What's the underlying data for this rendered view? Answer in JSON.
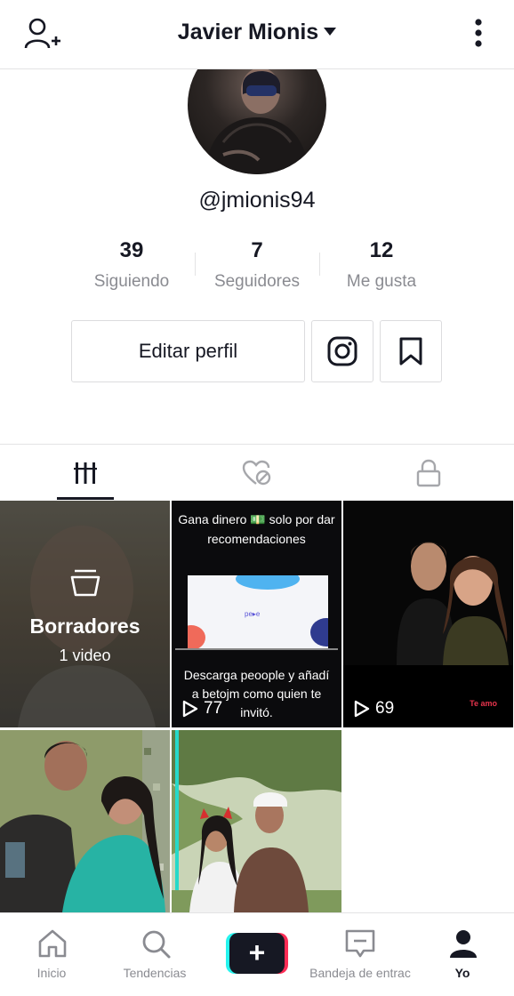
{
  "header": {
    "title": "Javier Mionis",
    "add_user_icon": "add-person-icon",
    "menu_icon": "more-vertical-icon"
  },
  "profile": {
    "handle": "@jmionis94",
    "stats": [
      {
        "value": "39",
        "label": "Siguiendo"
      },
      {
        "value": "7",
        "label": "Seguidores"
      },
      {
        "value": "12",
        "label": "Me gusta"
      }
    ],
    "edit_button_label": "Editar perfil",
    "instagram_icon": "instagram-icon",
    "bookmark_icon": "bookmark-icon"
  },
  "tabs": [
    {
      "icon": "grid-videos-icon",
      "active": true
    },
    {
      "icon": "liked-hidden-icon",
      "active": false
    },
    {
      "icon": "lock-icon",
      "active": false
    }
  ],
  "videos": [
    {
      "type": "drafts",
      "title": "Borradores",
      "count_text": "1 video"
    },
    {
      "type": "video",
      "caption_top": "Gana dinero 💵 solo por dar recomendaciones",
      "caption_bottom": "Descarga peoople y añadí a betojm como quien te invitó.",
      "plays": "77"
    },
    {
      "type": "video",
      "plays": "69",
      "watermark": "Te amo"
    },
    {
      "type": "video"
    },
    {
      "type": "video"
    }
  ],
  "bottom_nav": [
    {
      "label": "Inicio",
      "icon": "home-icon"
    },
    {
      "label": "Tendencias",
      "icon": "search-icon"
    },
    {
      "label": "",
      "icon": "plus-icon"
    },
    {
      "label": "Bandeja de entrac",
      "icon": "inbox-icon"
    },
    {
      "label": "Yo",
      "icon": "profile-icon",
      "active": true
    }
  ],
  "colors": {
    "text": "#161823",
    "muted": "#8a8b91",
    "accent_cyan": "#25f4ee",
    "accent_red": "#fe2c55"
  }
}
